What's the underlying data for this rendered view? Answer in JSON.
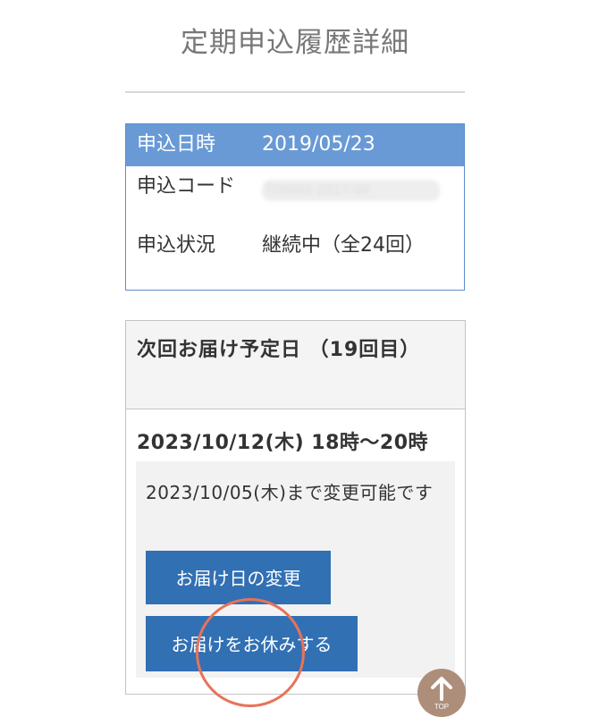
{
  "page": {
    "title": "定期申込履歴詳細"
  },
  "application_info": {
    "date_label": "申込日時",
    "date_value": "2019/05/23",
    "code_label": "申込コード",
    "code_value_hidden": "T00001-2017-00",
    "status_label": "申込状況",
    "status_value": "継続中（全24回）"
  },
  "delivery": {
    "header": "次回お届け予定日 （19回目）",
    "date": "2023/10/12(木) 18時〜20時",
    "notice": "2023/10/05(木)まで変更可能です",
    "change_button": "お届け日の変更",
    "skip_button": "お届けをお休みする"
  },
  "scroll_top": {
    "label": "TOP",
    "icon": "arrow-up-icon"
  },
  "colors": {
    "header_row_bg": "#699ad6",
    "button_bg": "#3270b4",
    "highlight_circle": "#e87359",
    "scroll_top_bg": "#ad8e7a"
  }
}
